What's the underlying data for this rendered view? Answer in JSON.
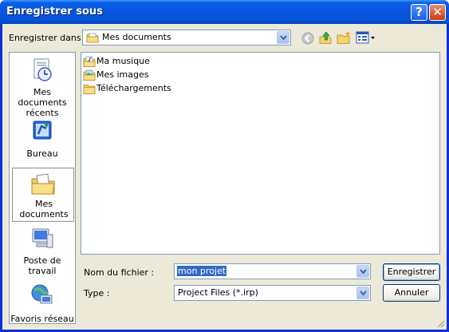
{
  "window": {
    "title": "Enregistrer sous",
    "help_label": "?",
    "close_label": "✕"
  },
  "toolbar": {
    "save_in_label": "Enregistrer dans :",
    "save_in_value": "Mes documents",
    "icons": [
      "back-icon",
      "up-folder-icon",
      "new-folder-icon",
      "views-menu-icon"
    ]
  },
  "places": [
    {
      "label": "Mes documents récents",
      "icon": "recent-documents-icon"
    },
    {
      "label": "Bureau",
      "icon": "desktop-icon"
    },
    {
      "label": "Mes documents",
      "icon": "my-documents-icon",
      "selected": true
    },
    {
      "label": "Poste de travail",
      "icon": "my-computer-icon"
    },
    {
      "label": "Favoris réseau",
      "icon": "network-places-icon"
    }
  ],
  "files": [
    {
      "name": "Ma musique",
      "icon": "music-folder-icon"
    },
    {
      "name": "Mes images",
      "icon": "pictures-folder-icon"
    },
    {
      "name": "Téléchargements",
      "icon": "folder-icon"
    }
  ],
  "form": {
    "filename_label": "Nom du fichier :",
    "filename_value": "mon projet",
    "type_label": "Type :",
    "type_value": "Project Files (*.irp)"
  },
  "buttons": {
    "save": "Enregistrer",
    "cancel": "Annuler"
  },
  "colors": {
    "titlebar": "#0855dd",
    "dialog_bg": "#ece9d8",
    "selection": "#316ac5",
    "border": "#7f9db9"
  }
}
